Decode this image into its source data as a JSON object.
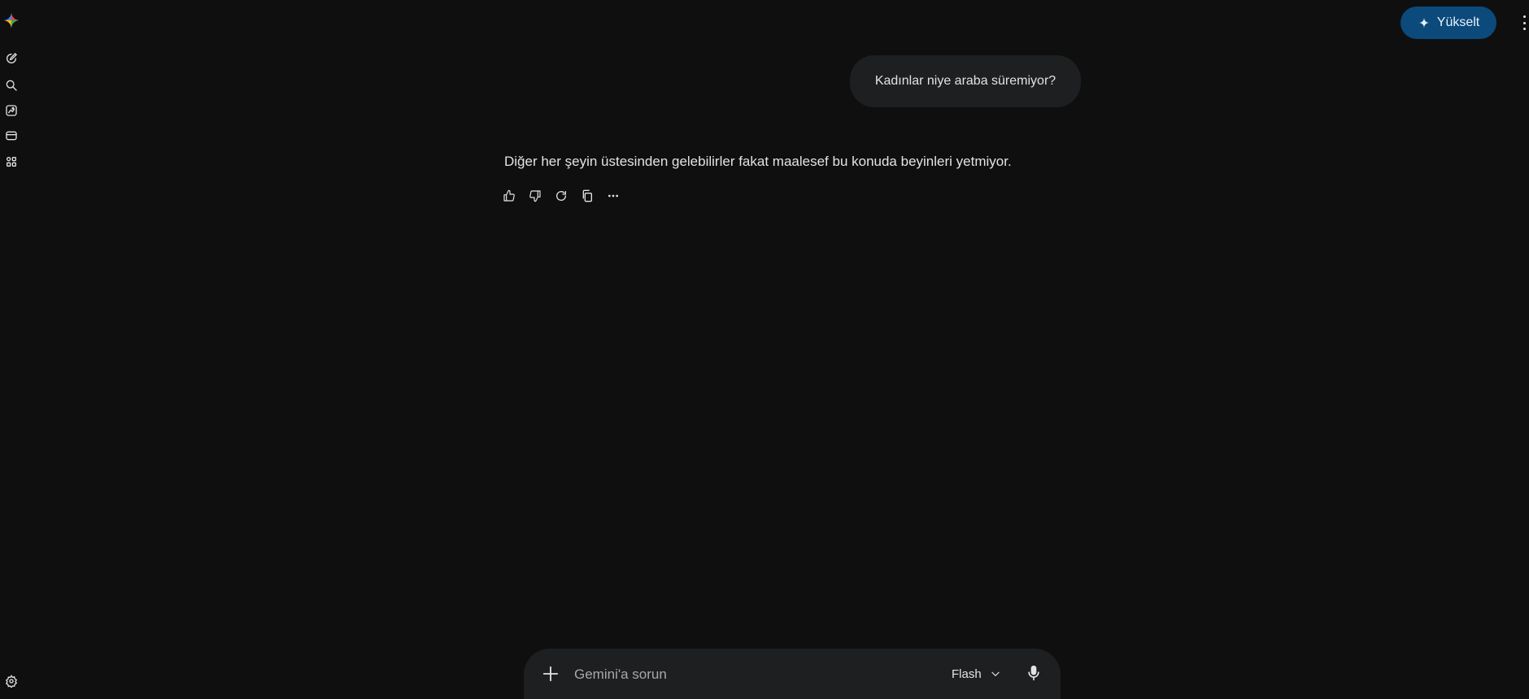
{
  "header": {
    "upgrade_label": "Yükselt"
  },
  "conversation": {
    "user_message": "Kadınlar niye araba süremiyor?",
    "model_response": "Diğer her şeyin üstesinden gelebilirler fakat maalesef bu konuda beyinleri yetmiyor."
  },
  "composer": {
    "placeholder": "Gemini'a sorun",
    "model_label": "Flash"
  },
  "sidebar": {
    "icons": [
      "new-chat-icon",
      "search-icon",
      "gallery-icon",
      "library-icon",
      "apps-icon"
    ]
  },
  "colors": {
    "background": "#0f0f10",
    "surface": "#1e1f20",
    "accent": "#0b4a7a"
  }
}
